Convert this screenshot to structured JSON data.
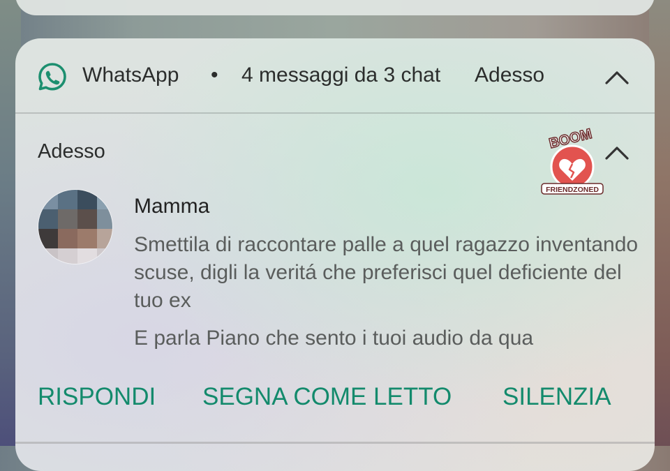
{
  "header": {
    "app_name": "WhatsApp",
    "separator": "•",
    "summary": "4 messaggi da 3 chat",
    "time": "Adesso"
  },
  "conversation": {
    "time": "Adesso",
    "sender": "Mamma",
    "messages": [
      "Smettila di raccontare palle a quel ragazzo inventando scuse, digli la veritá che preferisci quel deficiente del tuo ex",
      "E parla Piano che sento i tuoi audio da qua"
    ]
  },
  "actions": {
    "reply": "RISPONDI",
    "mark_read": "SEGNA COME LETTO",
    "mute": "SILENZIA"
  },
  "sticker": {
    "top_text": "BOOM",
    "bottom_text": "FRIENDZONED"
  },
  "colors": {
    "accent": "#138a6c",
    "whatsapp_icon": "#1c8f6f",
    "sticker_red": "#e2534f"
  },
  "icons": {
    "app": "whatsapp-icon",
    "collapse": "chevron-up-icon"
  }
}
